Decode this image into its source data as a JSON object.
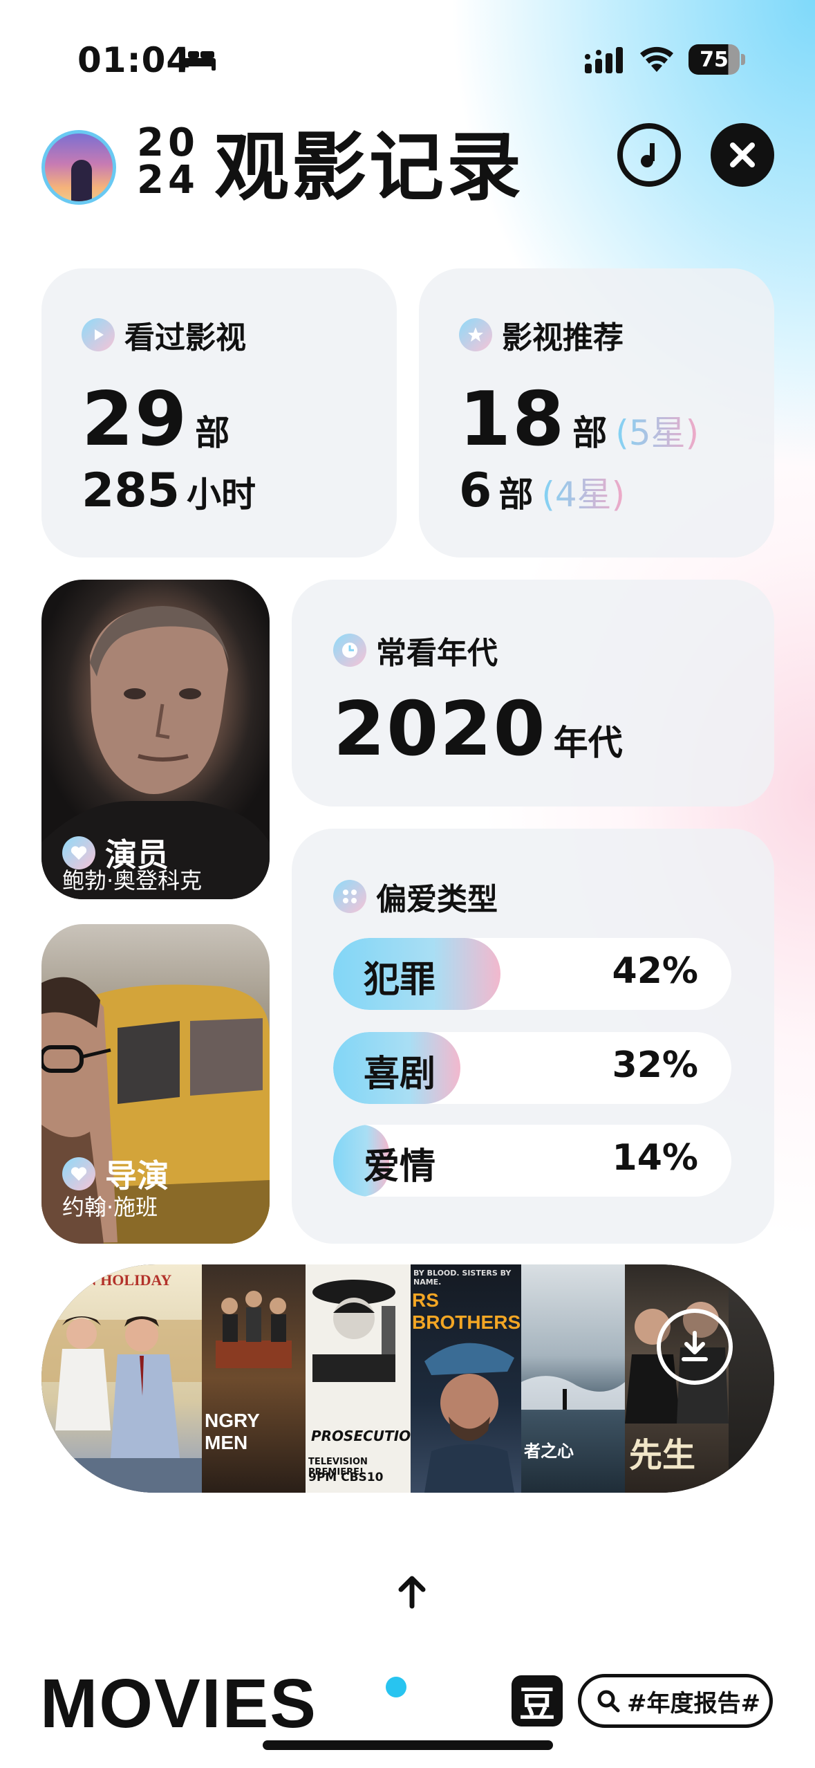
{
  "status_bar": {
    "time": "01:04",
    "battery": "75"
  },
  "header": {
    "year_top": "20",
    "year_bottom": "24",
    "title": "观影记录"
  },
  "watched": {
    "title": "看过影视",
    "count": "29",
    "count_unit": "部",
    "hours": "285",
    "hours_unit": "小时"
  },
  "recommend": {
    "title": "影视推荐",
    "five_star_count": "18",
    "five_star_unit": "部",
    "five_star_label": "(5星)",
    "four_star_count": "6",
    "four_star_unit": "部",
    "four_star_label": "(4星)"
  },
  "decade": {
    "title": "常看年代",
    "value": "2020",
    "unit": "年代"
  },
  "actor": {
    "role": "演员",
    "name": "鲍勃·奥登科克"
  },
  "director": {
    "role": "导演",
    "name": "约翰·施班"
  },
  "genres": {
    "title": "偏爱类型",
    "items": [
      {
        "label": "犯罪",
        "percent": "42%",
        "value": 42
      },
      {
        "label": "喜剧",
        "percent": "32%",
        "value": 32
      },
      {
        "label": "爱情",
        "percent": "14%",
        "value": 14
      }
    ]
  },
  "posters": {
    "roman_holiday": "OMAN HOLIDAY",
    "angry_men": "NGRY MEN",
    "brothers": "RS BROTHERS",
    "brothers_tagline": "BY BLOOD. SISTERS BY NAME.",
    "prosecution": "PROSECUTION",
    "premiere": "TELEVISION PREMIERE!",
    "cbs": "9PM CBS10",
    "poster6_text": "者之心",
    "poster7_text": "先生"
  },
  "footer": {
    "brand": "MOVIES",
    "douban_glyph": "豆",
    "hashtag": "#年度报告#"
  },
  "colors": {
    "accent_blue": "#28c4f0",
    "accent_pink": "#f2b8cd"
  }
}
